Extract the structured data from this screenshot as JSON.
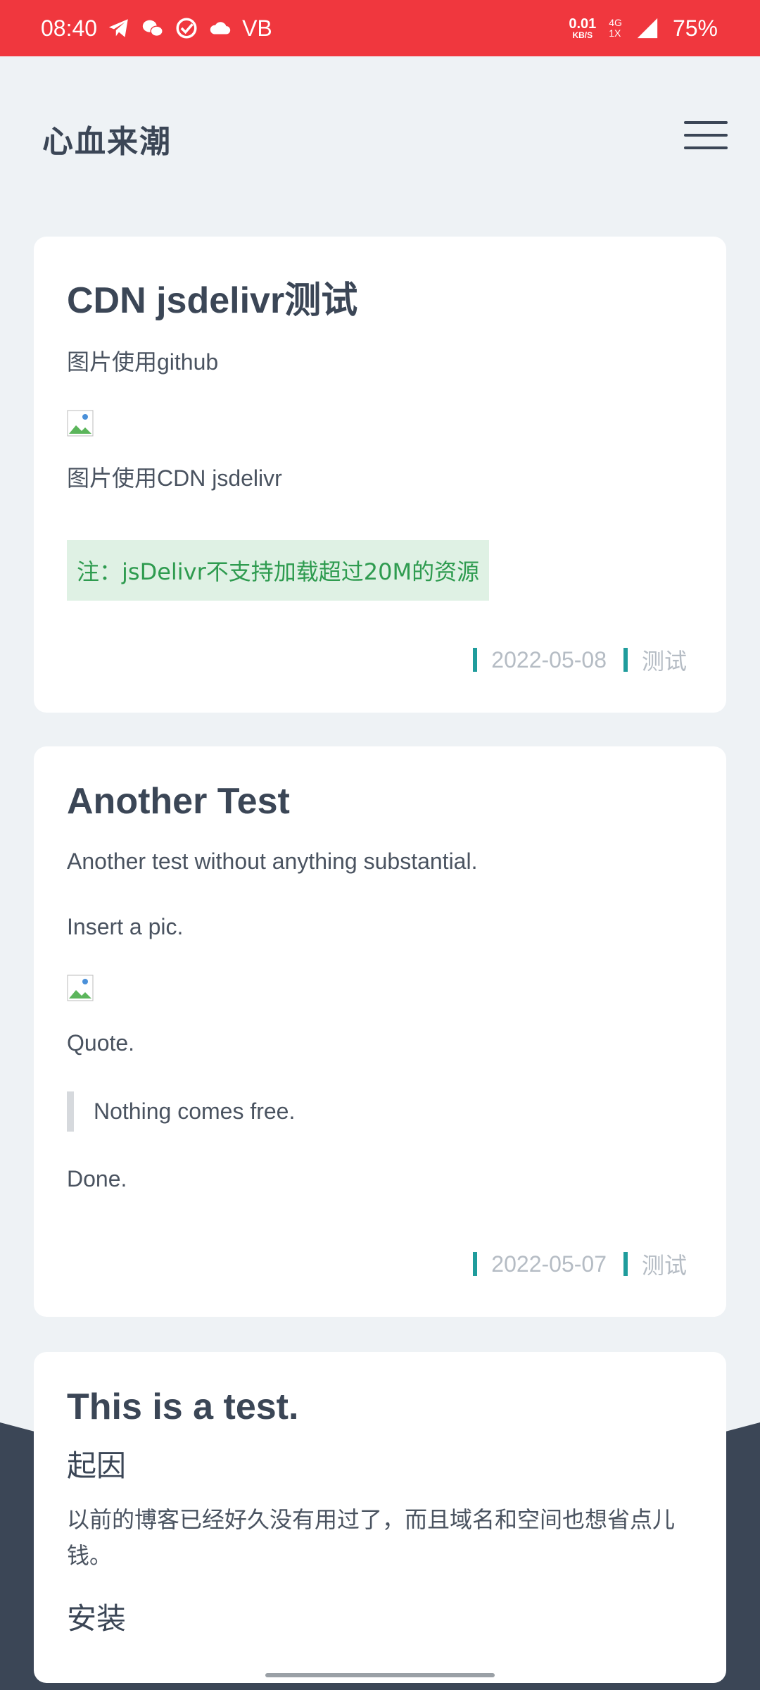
{
  "status_bar": {
    "time": "08:40",
    "carrier": "VB",
    "net_speed": "0.01",
    "net_unit": "KB/S",
    "net_type_top": "4G",
    "net_type_bottom": "1X",
    "battery": "75%"
  },
  "header": {
    "site_title": "心血来潮"
  },
  "posts": [
    {
      "title": "CDN jsdelivr测试",
      "para1": "图片使用github",
      "para2": "图片使用CDN jsdelivr",
      "note": "注：jsDelivr不支持加载超过20M的资源",
      "date": "2022-05-08",
      "tag": "测试"
    },
    {
      "title": "Another Test",
      "para1": "Another test without anything substantial.",
      "para2": "Insert a pic.",
      "para3": "Quote.",
      "quote": "Nothing comes free.",
      "para4": "Done.",
      "date": "2022-05-07",
      "tag": "测试"
    },
    {
      "title": "This is a test.",
      "heading1": "起因",
      "para1": "以前的博客已经好久没有用过了，而且域名和空间也想省点儿钱。",
      "heading2": "安装"
    }
  ]
}
